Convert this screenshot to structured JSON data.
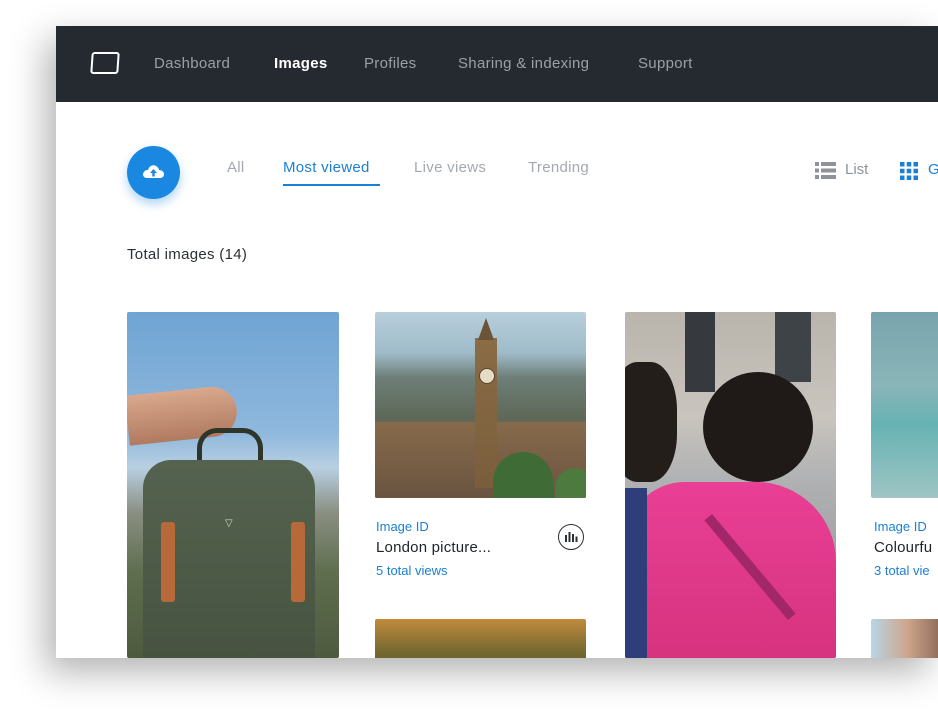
{
  "nav": {
    "items": [
      {
        "label": "Dashboard",
        "active": false
      },
      {
        "label": "Images",
        "active": true
      },
      {
        "label": "Profiles",
        "active": false
      },
      {
        "label": "Sharing & indexing",
        "active": false
      },
      {
        "label": "Support",
        "active": false
      }
    ]
  },
  "tabs": [
    {
      "label": "All",
      "active": false
    },
    {
      "label": "Most viewed",
      "active": true
    },
    {
      "label": "Live views",
      "active": false
    },
    {
      "label": "Trending",
      "active": false
    }
  ],
  "view_toggle": {
    "list_label": "List",
    "grid_label": "G"
  },
  "total_label": "Total images (14)",
  "cards": [
    {
      "image": "backpack-photo"
    },
    {
      "image": "london-photo",
      "id_label": "Image ID",
      "name": "London picture...",
      "views": "5 total views"
    },
    {
      "image": "pink-hoodie-photo"
    },
    {
      "image": "sea-photo",
      "id_label": "Image ID",
      "name": "Colourfu",
      "views": "3 total vie"
    }
  ],
  "colors": {
    "topbar": "#252a31",
    "accent": "#1a7fd5",
    "upload_button": "#1a87e0"
  },
  "icons": [
    "logo-icon",
    "upload-cloud-icon",
    "list-icon",
    "grid-icon",
    "stats-icon"
  ]
}
